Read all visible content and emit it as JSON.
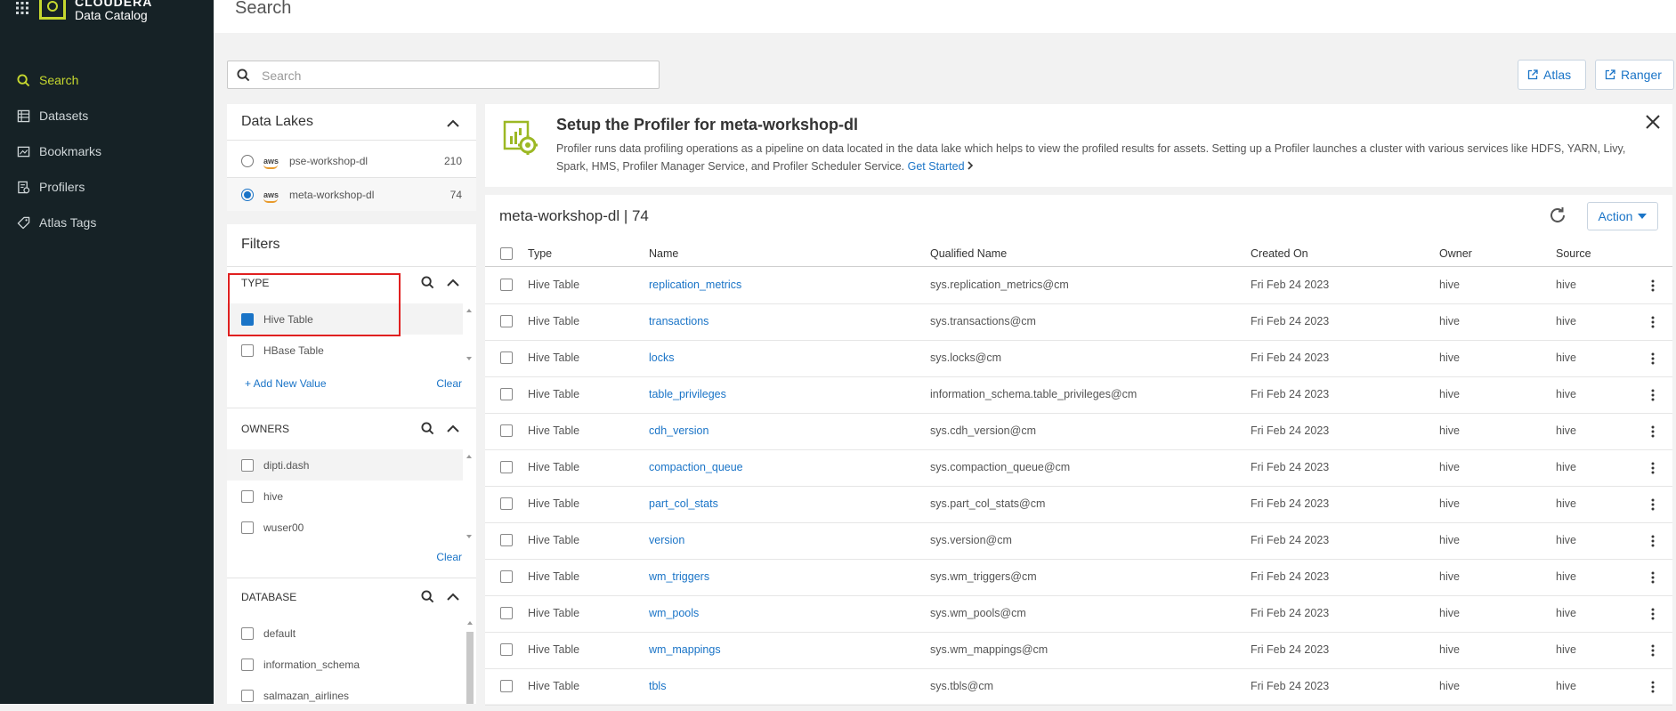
{
  "brand": {
    "top": "CLOUDERA",
    "sub": "Data Catalog"
  },
  "nav": [
    {
      "label": "Search",
      "icon": "search-icon",
      "active": true
    },
    {
      "label": "Datasets",
      "icon": "datasets-icon"
    },
    {
      "label": "Bookmarks",
      "icon": "bookmarks-icon"
    },
    {
      "label": "Profilers",
      "icon": "profilers-icon"
    },
    {
      "label": "Atlas Tags",
      "icon": "tag-icon"
    }
  ],
  "header": {
    "title": "Search"
  },
  "search": {
    "placeholder": "Search",
    "value": ""
  },
  "external_links": {
    "atlas": "Atlas",
    "ranger": "Ranger"
  },
  "data_lakes": {
    "title": "Data Lakes",
    "items": [
      {
        "provider": "aws",
        "name": "pse-workshop-dl",
        "count": "210",
        "selected": false
      },
      {
        "provider": "aws",
        "name": "meta-workshop-dl",
        "count": "74",
        "selected": true
      }
    ]
  },
  "filters": {
    "title": "Filters",
    "type": {
      "label": "TYPE",
      "options": [
        {
          "label": "Hive Table",
          "checked": true
        },
        {
          "label": "HBase Table",
          "checked": false
        }
      ],
      "add_new": "+ Add New Value",
      "clear": "Clear"
    },
    "owners": {
      "label": "OWNERS",
      "options": [
        {
          "label": "dipti.dash",
          "checked": false
        },
        {
          "label": "hive",
          "checked": false
        },
        {
          "label": "wuser00",
          "checked": false
        }
      ],
      "clear": "Clear"
    },
    "database": {
      "label": "DATABASE",
      "options": [
        {
          "label": "default",
          "checked": false
        },
        {
          "label": "information_schema",
          "checked": false
        },
        {
          "label": "salmazan_airlines",
          "checked": false
        }
      ]
    }
  },
  "banner": {
    "title": "Setup the Profiler for meta-workshop-dl",
    "text": "Profiler runs data profiling operations as a pipeline on data located in the data lake which helps to view the profiled results for assets. Setting up a Profiler launches a cluster with various services like HDFS, YARN, Livy, Spark, HMS, Profiler Manager Service, and Profiler Scheduler Service.",
    "link": "Get Started"
  },
  "table": {
    "title": "meta-workshop-dl | 74",
    "action_label": "Action",
    "columns": {
      "type": "Type",
      "name": "Name",
      "qualified": "Qualified Name",
      "created": "Created On",
      "owner": "Owner",
      "source": "Source"
    },
    "rows": [
      {
        "type": "Hive Table",
        "name": "replication_metrics",
        "qualified": "sys.replication_metrics@cm",
        "created": "Fri Feb 24 2023",
        "owner": "hive",
        "source": "hive"
      },
      {
        "type": "Hive Table",
        "name": "transactions",
        "qualified": "sys.transactions@cm",
        "created": "Fri Feb 24 2023",
        "owner": "hive",
        "source": "hive"
      },
      {
        "type": "Hive Table",
        "name": "locks",
        "qualified": "sys.locks@cm",
        "created": "Fri Feb 24 2023",
        "owner": "hive",
        "source": "hive"
      },
      {
        "type": "Hive Table",
        "name": "table_privileges",
        "qualified": "information_schema.table_privileges@cm",
        "created": "Fri Feb 24 2023",
        "owner": "hive",
        "source": "hive"
      },
      {
        "type": "Hive Table",
        "name": "cdh_version",
        "qualified": "sys.cdh_version@cm",
        "created": "Fri Feb 24 2023",
        "owner": "hive",
        "source": "hive"
      },
      {
        "type": "Hive Table",
        "name": "compaction_queue",
        "qualified": "sys.compaction_queue@cm",
        "created": "Fri Feb 24 2023",
        "owner": "hive",
        "source": "hive"
      },
      {
        "type": "Hive Table",
        "name": "part_col_stats",
        "qualified": "sys.part_col_stats@cm",
        "created": "Fri Feb 24 2023",
        "owner": "hive",
        "source": "hive"
      },
      {
        "type": "Hive Table",
        "name": "version",
        "qualified": "sys.version@cm",
        "created": "Fri Feb 24 2023",
        "owner": "hive",
        "source": "hive"
      },
      {
        "type": "Hive Table",
        "name": "wm_triggers",
        "qualified": "sys.wm_triggers@cm",
        "created": "Fri Feb 24 2023",
        "owner": "hive",
        "source": "hive"
      },
      {
        "type": "Hive Table",
        "name": "wm_pools",
        "qualified": "sys.wm_pools@cm",
        "created": "Fri Feb 24 2023",
        "owner": "hive",
        "source": "hive"
      },
      {
        "type": "Hive Table",
        "name": "wm_mappings",
        "qualified": "sys.wm_mappings@cm",
        "created": "Fri Feb 24 2023",
        "owner": "hive",
        "source": "hive"
      },
      {
        "type": "Hive Table",
        "name": "tbls",
        "qualified": "sys.tbls@cm",
        "created": "Fri Feb 24 2023",
        "owner": "hive",
        "source": "hive"
      }
    ]
  },
  "colors": {
    "accent": "#1a74c7",
    "brand": "#c6d82f",
    "sidebar": "#162226",
    "highlight_box": "#e02020"
  }
}
